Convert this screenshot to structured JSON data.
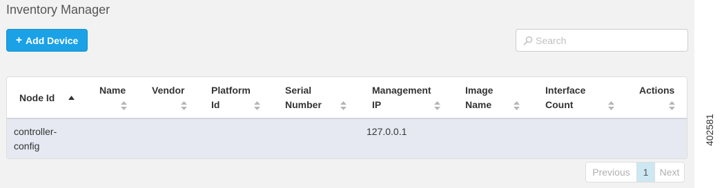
{
  "page": {
    "title": "Inventory Manager"
  },
  "toolbar": {
    "add_label": "Add Device",
    "add_icon": "plus-icon"
  },
  "search": {
    "placeholder": "Search",
    "value": ""
  },
  "table": {
    "columns": [
      {
        "line1": "Node Id",
        "line2": "",
        "sort": "asc"
      },
      {
        "line1": "Name",
        "line2": "",
        "sort": "none"
      },
      {
        "line1": "Vendor",
        "line2": "",
        "sort": "none"
      },
      {
        "line1": "Platform",
        "line2": "Id",
        "sort": "none"
      },
      {
        "line1": "Serial",
        "line2": "Number",
        "sort": "none"
      },
      {
        "line1": "Management",
        "line2": "IP",
        "sort": "none"
      },
      {
        "line1": "Image",
        "line2": "Name",
        "sort": "none"
      },
      {
        "line1": "Interface",
        "line2": "Count",
        "sort": "none"
      },
      {
        "line1": "Actions",
        "line2": "",
        "sort": "none"
      }
    ],
    "rows": [
      {
        "node_id_line1": "controller-",
        "node_id_line2": "config",
        "name": "",
        "vendor": "",
        "platform_id": "",
        "serial_number": "",
        "management_ip": "127.0.0.1",
        "image_name": "",
        "interface_count": "",
        "actions": ""
      }
    ]
  },
  "pagination": {
    "previous": "Previous",
    "current": "1",
    "next": "Next"
  },
  "figure_id": "402581",
  "colors": {
    "accent": "#1aa1e6",
    "row_bg": "#e6e9f2",
    "active_page": "#cde8f2",
    "panel_bg": "#f2f2f2"
  }
}
